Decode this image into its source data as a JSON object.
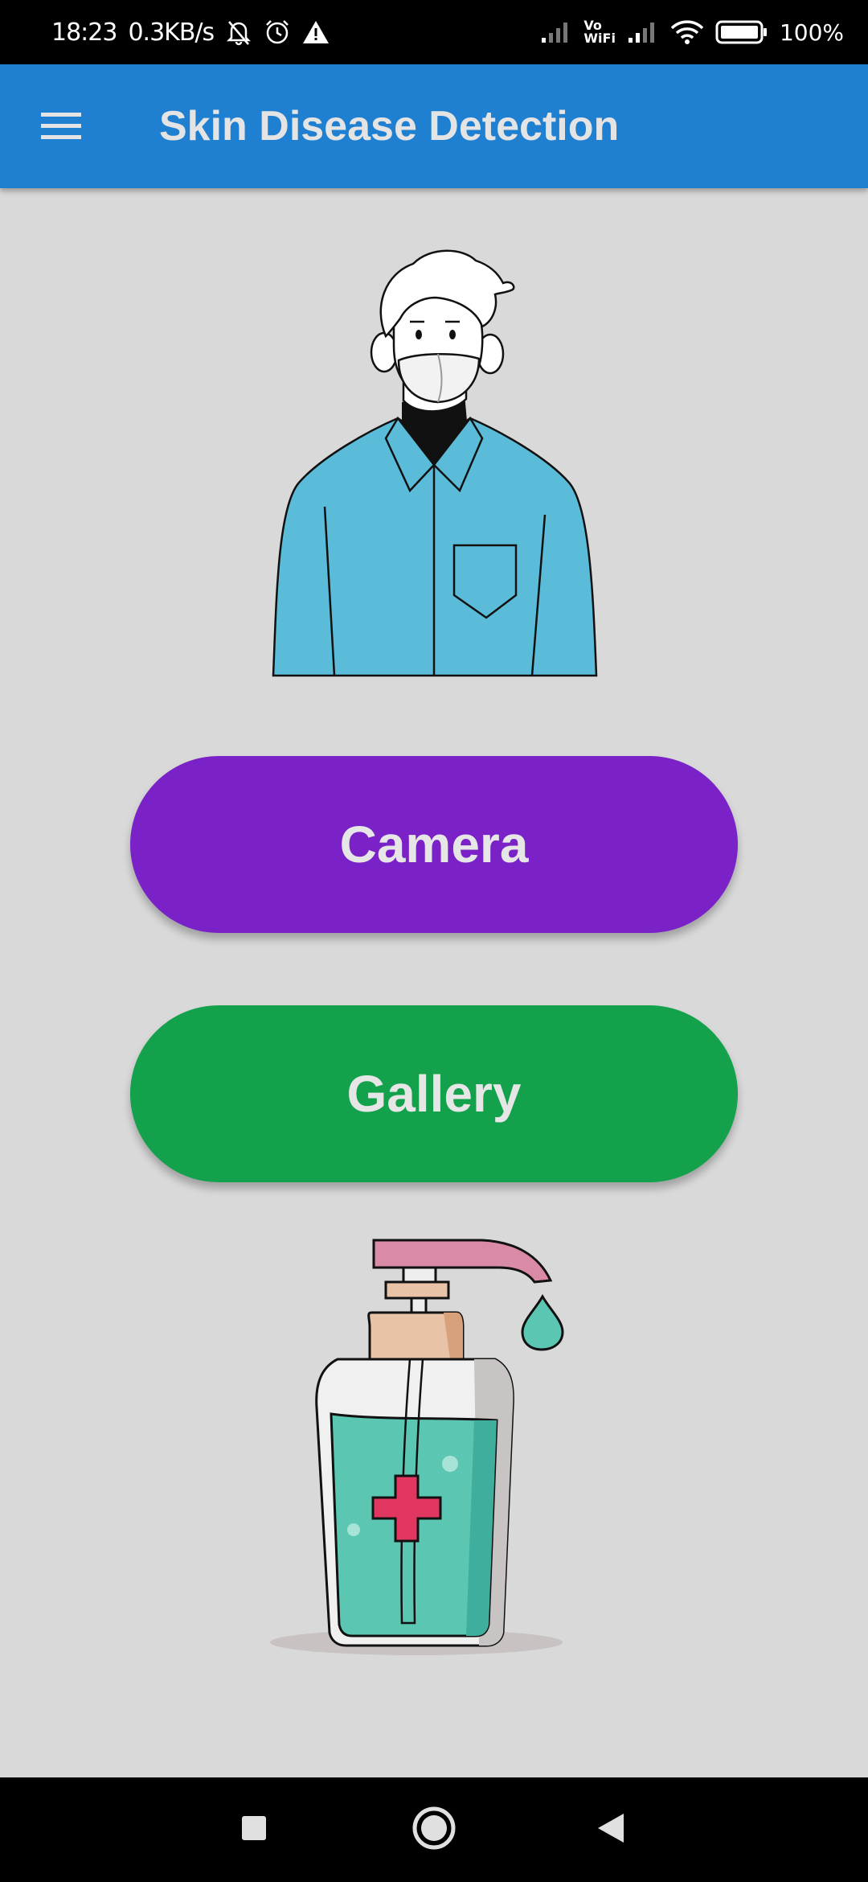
{
  "status_bar": {
    "time": "18:23",
    "speed": "0.3KB/s",
    "battery": "100%",
    "icons": [
      "muted-bell-icon",
      "alarm-icon",
      "warning-icon",
      "signal-icon",
      "vowifi-icon",
      "signal-icon",
      "wifi-icon",
      "battery-icon"
    ],
    "vowifi_top": "Vo",
    "vowifi_bottom": "WiFi"
  },
  "app_bar": {
    "title": "Skin Disease Detection",
    "menu_icon": "hamburger-menu-icon",
    "color": "#1f7fd0"
  },
  "main": {
    "camera_label": "Camera",
    "gallery_label": "Gallery",
    "camera_color": "#7a22c7",
    "gallery_color": "#14a14c",
    "illustrations": [
      "masked-person-illustration",
      "hand-sanitizer-illustration"
    ]
  },
  "nav_bar": {
    "icons": [
      "recents-square-icon",
      "home-circle-icon",
      "back-triangle-icon"
    ]
  }
}
